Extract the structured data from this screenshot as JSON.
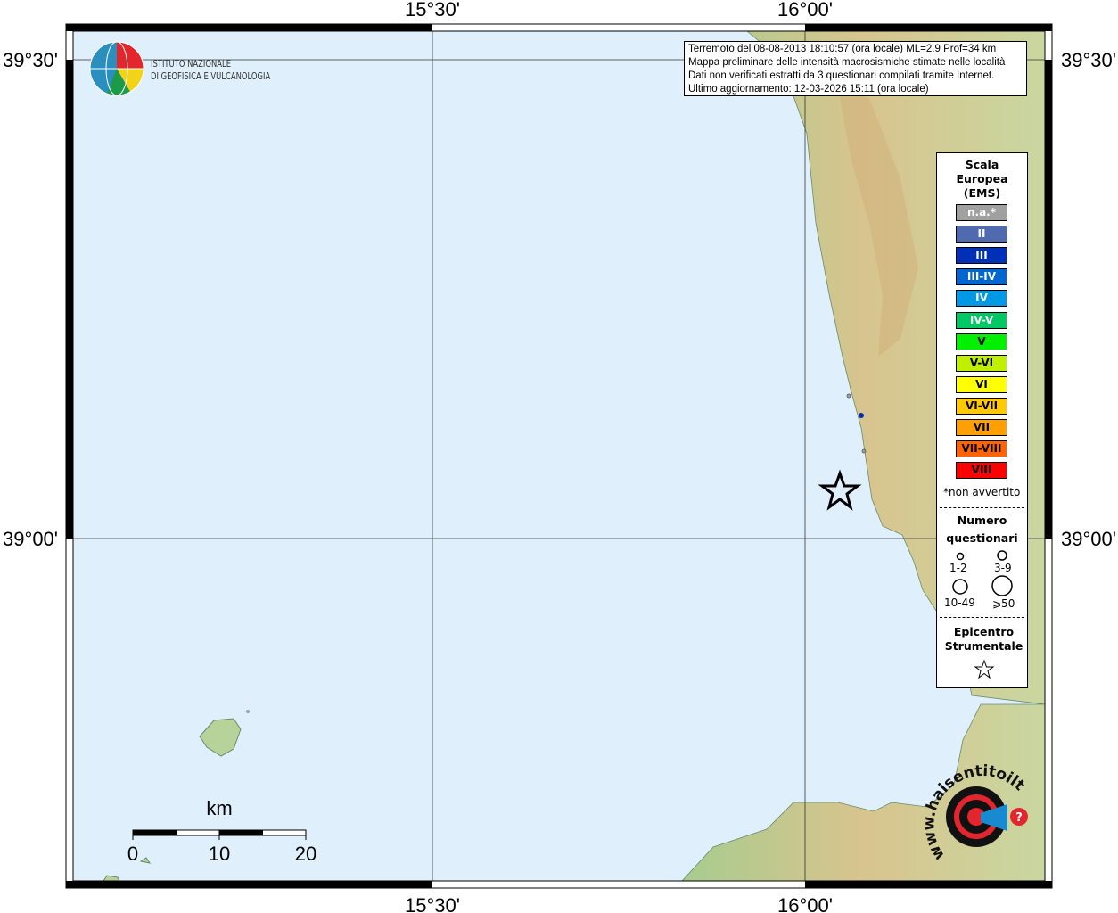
{
  "info_box": {
    "line1": "Terremoto del 08-08-2013 18:10:57 (ora locale) ML=2.9 Prof=34 km",
    "line2": "Mappa preliminare delle intensità macrosismiche stimate nelle località",
    "line3": "Dati non verificati estratti da 3 questionari compilati tramite Internet.",
    "line4": "Ultimo aggiornamento: 12-03-2026 15:11 (ora locale)"
  },
  "logo": {
    "line1": "ISTITUTO NAZIONALE",
    "line2": "DI GEOFISICA E VULCANOLOGIA"
  },
  "axes": {
    "lon_labels": [
      "15°30'",
      "16°00'"
    ],
    "lat_labels": [
      "39°30'",
      "39°00'"
    ]
  },
  "legend": {
    "title": [
      "Scala",
      "Europea",
      "(EMS)"
    ],
    "classes": [
      {
        "label": "n.a.*",
        "color": "#a0a0a0"
      },
      {
        "label": "II",
        "color": "#4f6aae"
      },
      {
        "label": "III",
        "color": "#0030b8"
      },
      {
        "label": "III-IV",
        "color": "#0066d0"
      },
      {
        "label": "IV",
        "color": "#0099e6"
      },
      {
        "label": "IV-V",
        "color": "#00c864"
      },
      {
        "label": "V",
        "color": "#00f000"
      },
      {
        "label": "V-VI",
        "color": "#c0f000"
      },
      {
        "label": "VI",
        "color": "#ffff00"
      },
      {
        "label": "VI-VII",
        "color": "#ffc800"
      },
      {
        "label": "VII",
        "color": "#ffa000"
      },
      {
        "label": "VII-VIII",
        "color": "#ff6400"
      },
      {
        "label": "VIII",
        "color": "#ff0000"
      }
    ],
    "note": "*non avvertito",
    "count_title": [
      "Numero",
      "questionari"
    ],
    "counts": [
      "1-2",
      "3-9",
      "10-49",
      "⩾50"
    ],
    "epicenter_title": [
      "Epicentro",
      "Strumentale"
    ]
  },
  "scale_bar": {
    "unit": "km",
    "ticks": [
      "0",
      "10",
      "20"
    ]
  },
  "observations": [
    {
      "intensity": "n.a.*",
      "questionari": "1-2"
    },
    {
      "intensity": "III",
      "questionari": "1-2"
    },
    {
      "intensity": "n.a.*",
      "questionari": "1-2"
    }
  ],
  "watermark": "www.haisentitoilterremoto.it",
  "colors": {
    "sea": "#dff0fc",
    "land": "#b8d39a"
  }
}
